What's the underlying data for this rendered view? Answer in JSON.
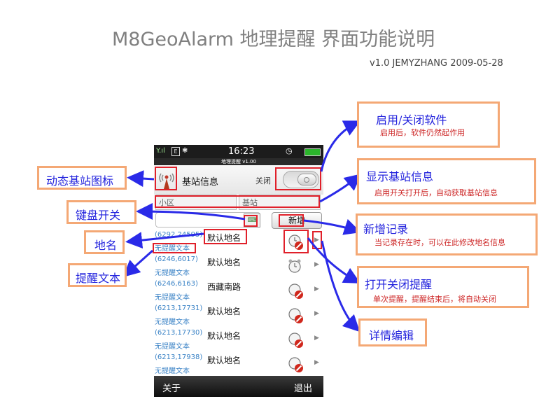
{
  "doc": {
    "title": "M8GeoAlarm 地理提醒 界面功能说明",
    "version": "v1.0 JEMYZHANG 2009-05-28"
  },
  "statusbar": {
    "signal": "Y.ıl",
    "e_icon": "E",
    "bluetooth": "✱",
    "time": "16:23",
    "clock_icon": "◷"
  },
  "app": {
    "title": "地理提醒 v1.00",
    "header_label": "基站信息",
    "toggle_label": "关闭",
    "cell_placeholder": "小区",
    "station_placeholder": "基站",
    "keyboard_icon": "⌨",
    "add_button": "新增",
    "rows": [
      {
        "coord": "(6292,24595)",
        "remind": "无提醒文本",
        "name": "默认地名"
      },
      {
        "coord": "(6246,6017)",
        "remind": "无提醒文本",
        "name": "默认地名"
      },
      {
        "coord": "(6246,6163)",
        "remind": "无提醒文本",
        "name": "西藏南路"
      },
      {
        "coord": "(6213,17731)",
        "remind": "无提醒文本",
        "name": "默认地名"
      },
      {
        "coord": "(6213,17730)",
        "remind": "无提醒文本",
        "name": "默认地名"
      },
      {
        "coord": "(6213,17938)",
        "remind": "无提醒文本",
        "name": "默认地名"
      }
    ],
    "footer_about": "关于",
    "footer_exit": "退出"
  },
  "callouts": {
    "left": [
      {
        "title": "动态基站图标"
      },
      {
        "title": "键盘开关"
      },
      {
        "title": "地名"
      },
      {
        "title": "提醒文本"
      }
    ],
    "right": [
      {
        "title": "启用/关闭软件",
        "desc": "启用后，软件仍然起作用"
      },
      {
        "title": "显示基站信息",
        "desc": "启用开关打开后，自动获取基站信息"
      },
      {
        "title": "新增记录",
        "desc": "当记录存在时，可以在此修改地名信息"
      },
      {
        "title": "打开关闭提醒",
        "desc": "单次提醒，提醒结束后，将自动关闭"
      },
      {
        "title": "详情编辑"
      }
    ]
  },
  "colors": {
    "highlight": "#e0202a",
    "callout_border": "#f4a875",
    "callout_title": "#2222dd",
    "callout_desc": "#cc2222",
    "arrow": "#2a2ae8",
    "link_text": "#3b83c6"
  }
}
